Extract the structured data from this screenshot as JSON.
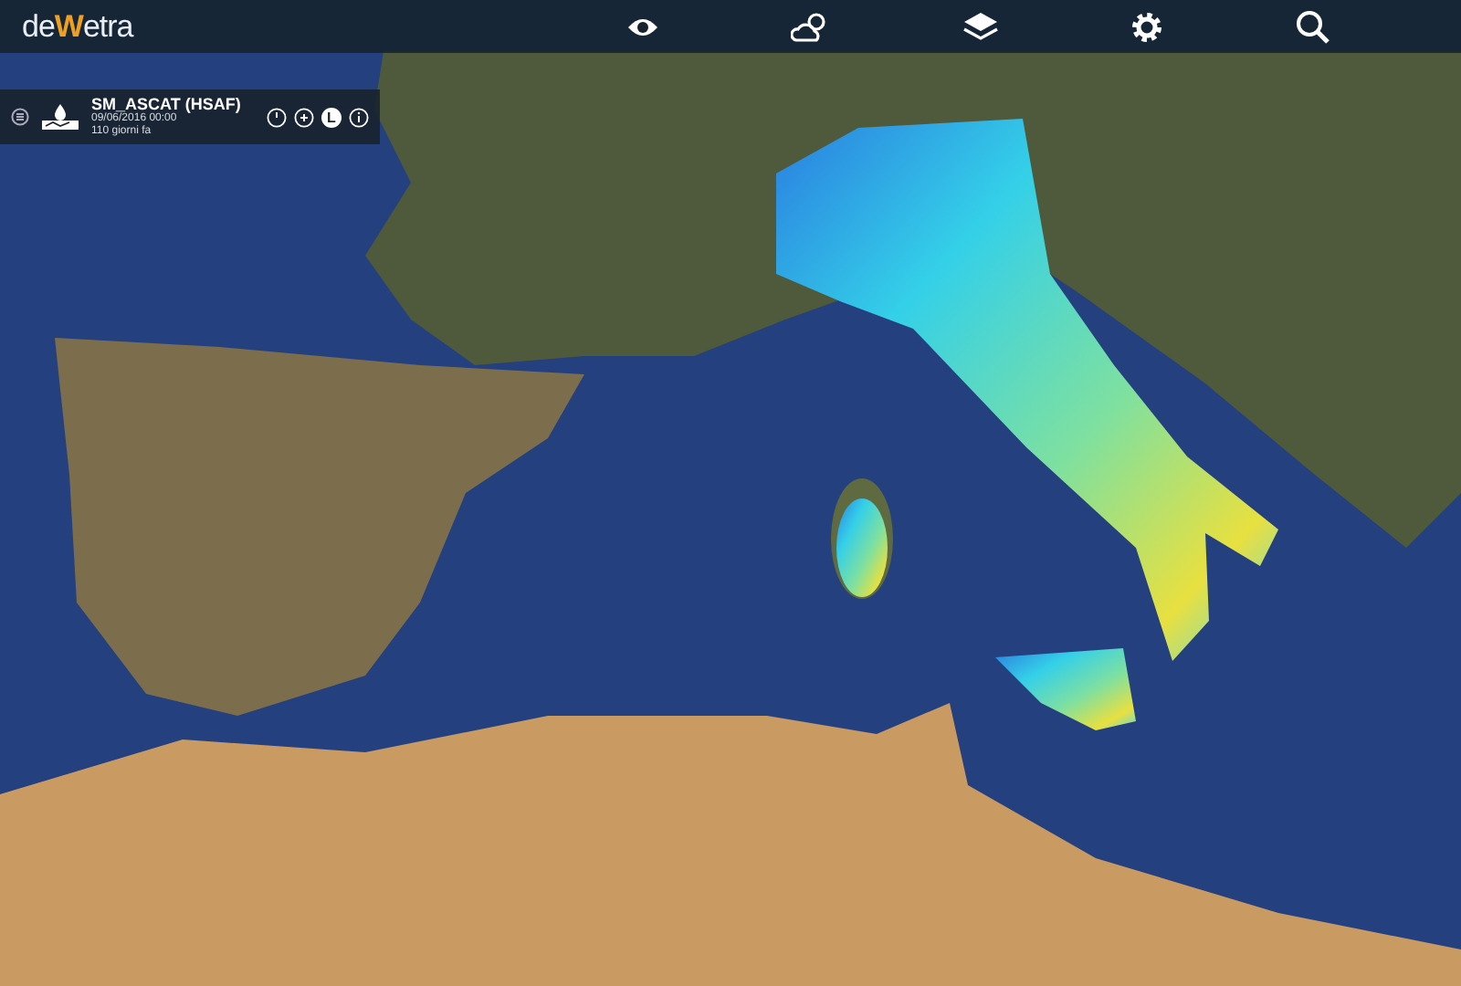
{
  "app": {
    "logo": "deWetra"
  },
  "layer_panel": {
    "title": "SM_ASCAT (HSAF)",
    "date": "09/06/2016 00:00",
    "age": "110 giorni fa",
    "legend_key": "L"
  }
}
